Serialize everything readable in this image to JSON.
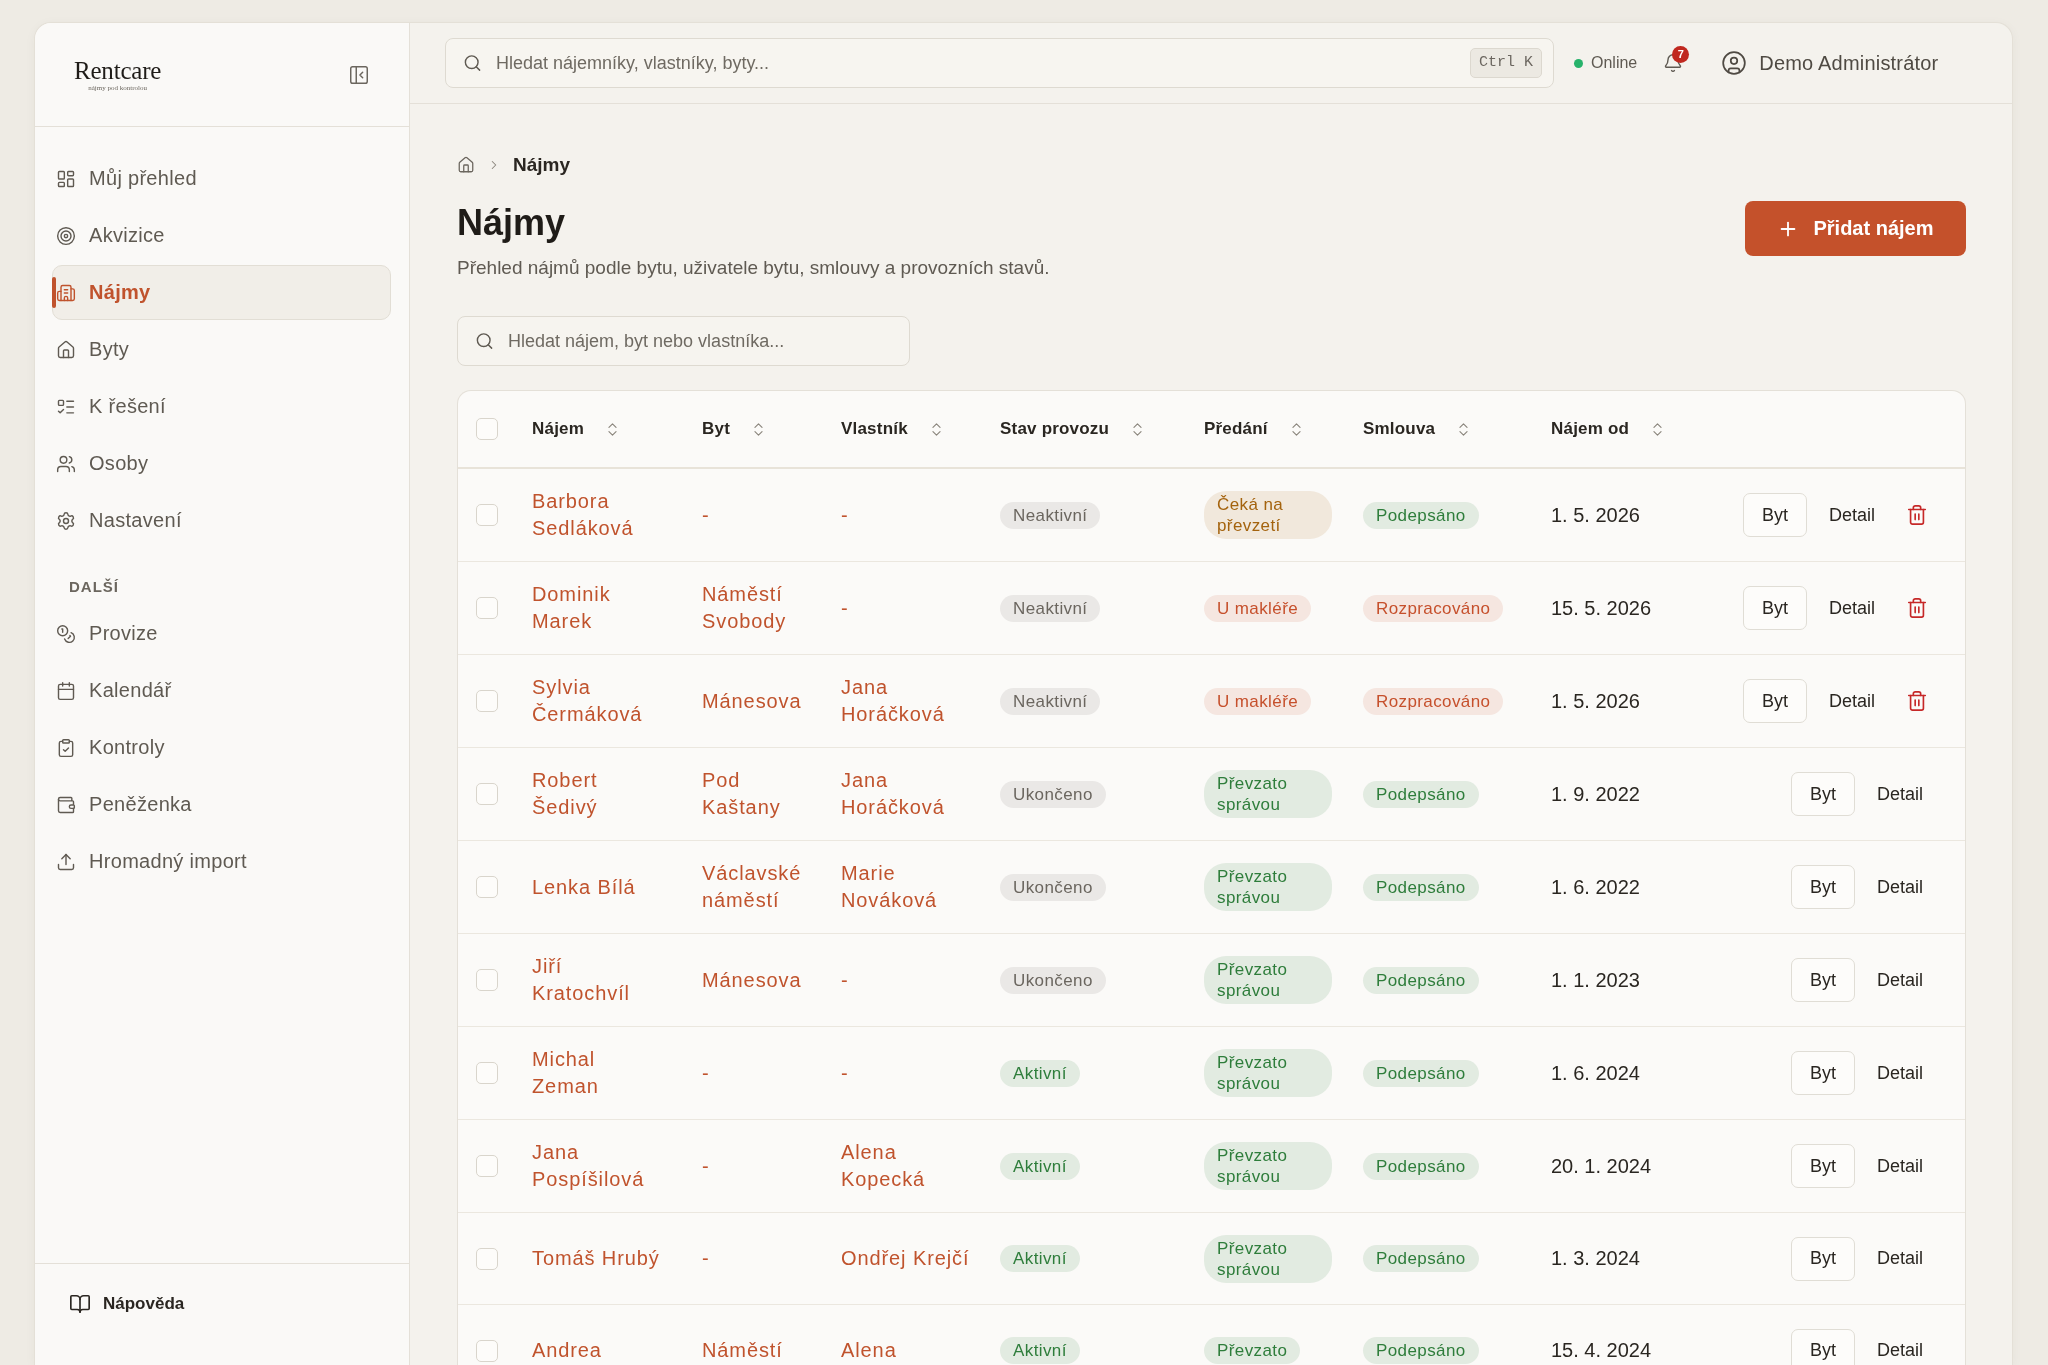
{
  "sidebar": {
    "brand": {
      "name": "Rentcare",
      "tagline": "nájmy pod kontrolou"
    },
    "items": [
      {
        "label": "Můj přehled",
        "selected": false
      },
      {
        "label": "Akvizice",
        "selected": false
      },
      {
        "label": "Nájmy",
        "selected": true
      },
      {
        "label": "Byty",
        "selected": false
      },
      {
        "label": "K řešení",
        "selected": false
      },
      {
        "label": "Osoby",
        "selected": false
      },
      {
        "label": "Nastavení",
        "selected": false
      }
    ],
    "section": {
      "title": "DALŠÍ",
      "items": [
        {
          "label": "Provize",
          "selected": false
        },
        {
          "label": "Kalendář",
          "selected": false
        },
        {
          "label": "Kontroly",
          "selected": false
        },
        {
          "label": "Peněženka",
          "selected": false
        },
        {
          "label": "Hromadný import",
          "selected": false
        }
      ]
    },
    "footer": {
      "label": "Nápověda"
    }
  },
  "topbar": {
    "search": {
      "placeholder": "Hledat nájemníky, vlastníky, byty...",
      "shortcut": "Ctrl K"
    },
    "status": {
      "label": "Online",
      "online": true
    },
    "notifications": {
      "count": "7"
    },
    "user": {
      "name": "Demo Administrátor"
    }
  },
  "breadcrumb": {
    "current": "Nájmy"
  },
  "page": {
    "title": "Nájmy",
    "subtitle": "Přehled nájmů podle bytu, uživatele bytu, smlouvy a provozních stavů.",
    "primary_action": {
      "label": "Přidat nájem"
    }
  },
  "filter": {
    "placeholder": "Hledat nájem, byt nebo vlastníka..."
  },
  "table": {
    "select_all": {
      "checked": false
    },
    "columns": [
      {
        "label": "Nájem",
        "sortable": true
      },
      {
        "label": "Byt",
        "sortable": true
      },
      {
        "label": "Vlastník",
        "sortable": true
      },
      {
        "label": "Stav provozu",
        "sortable": true
      },
      {
        "label": "Předání",
        "sortable": true
      },
      {
        "label": "Smlouva",
        "sortable": true
      },
      {
        "label": "Nájem od",
        "sortable": true
      }
    ],
    "rows": [
      {
        "selected": false,
        "tenant": "Barbora Sedláková",
        "apartment": "-",
        "owner": "-",
        "operation_status": {
          "label": "Neaktivní",
          "color": "#6b665f"
        },
        "handover": {
          "label": "Čeká na převzetí",
          "color": "#a4630e"
        },
        "contract": {
          "label": "Podepsáno",
          "color": "#2e7d3b"
        },
        "start_date": "1. 5. 2026",
        "actions": [
          {
            "label": "Byt",
            "kind": "outline"
          },
          {
            "label": "Detail",
            "kind": "ghost"
          }
        ],
        "deletable": true
      },
      {
        "selected": false,
        "tenant": "Dominik Marek",
        "apartment": "Náměstí Svobody",
        "owner": "-",
        "operation_status": {
          "label": "Neaktivní",
          "color": "#6b665f"
        },
        "handover": {
          "label": "U makléře",
          "color": "#c6502c"
        },
        "contract": {
          "label": "Rozpracováno",
          "color": "#c6502c"
        },
        "start_date": "15. 5. 2026",
        "actions": [
          {
            "label": "Byt",
            "kind": "outline"
          },
          {
            "label": "Detail",
            "kind": "ghost"
          }
        ],
        "deletable": true
      },
      {
        "selected": false,
        "tenant": "Sylvia Čermáková",
        "apartment": "Mánesova",
        "owner": "Jana Horáčková",
        "operation_status": {
          "label": "Neaktivní",
          "color": "#6b665f"
        },
        "handover": {
          "label": "U makléře",
          "color": "#c6502c"
        },
        "contract": {
          "label": "Rozpracováno",
          "color": "#c6502c"
        },
        "start_date": "1. 5. 2026",
        "actions": [
          {
            "label": "Byt",
            "kind": "outline"
          },
          {
            "label": "Detail",
            "kind": "ghost"
          }
        ],
        "deletable": true
      },
      {
        "selected": false,
        "tenant": "Robert Šedivý",
        "apartment": "Pod Kaštany",
        "owner": "Jana Horáčková",
        "operation_status": {
          "label": "Ukončeno",
          "color": "#6b665f"
        },
        "handover": {
          "label": "Převzato správou",
          "color": "#2e7d3b"
        },
        "contract": {
          "label": "Podepsáno",
          "color": "#2e7d3b"
        },
        "start_date": "1. 9. 2022",
        "actions": [
          {
            "label": "Byt",
            "kind": "outline"
          },
          {
            "label": "Detail",
            "kind": "ghost"
          }
        ],
        "deletable": false
      },
      {
        "selected": false,
        "tenant": "Lenka Bílá",
        "apartment": "Václavské náměstí",
        "owner": "Marie Nováková",
        "operation_status": {
          "label": "Ukončeno",
          "color": "#6b665f"
        },
        "handover": {
          "label": "Převzato správou",
          "color": "#2e7d3b"
        },
        "contract": {
          "label": "Podepsáno",
          "color": "#2e7d3b"
        },
        "start_date": "1. 6. 2022",
        "actions": [
          {
            "label": "Byt",
            "kind": "outline"
          },
          {
            "label": "Detail",
            "kind": "ghost"
          }
        ],
        "deletable": false
      },
      {
        "selected": false,
        "tenant": "Jiří Kratochvíl",
        "apartment": "Mánesova",
        "owner": "-",
        "operation_status": {
          "label": "Ukončeno",
          "color": "#6b665f"
        },
        "handover": {
          "label": "Převzato správou",
          "color": "#2e7d3b"
        },
        "contract": {
          "label": "Podepsáno",
          "color": "#2e7d3b"
        },
        "start_date": "1. 1. 2023",
        "actions": [
          {
            "label": "Byt",
            "kind": "outline"
          },
          {
            "label": "Detail",
            "kind": "ghost"
          }
        ],
        "deletable": false
      },
      {
        "selected": false,
        "tenant": "Michal Zeman",
        "apartment": "-",
        "owner": "-",
        "operation_status": {
          "label": "Aktivní",
          "color": "#2e7d3b"
        },
        "handover": {
          "label": "Převzato správou",
          "color": "#2e7d3b"
        },
        "contract": {
          "label": "Podepsáno",
          "color": "#2e7d3b"
        },
        "start_date": "1. 6. 2024",
        "actions": [
          {
            "label": "Byt",
            "kind": "outline"
          },
          {
            "label": "Detail",
            "kind": "ghost"
          }
        ],
        "deletable": false
      },
      {
        "selected": false,
        "tenant": "Jana Pospíšilová",
        "apartment": "-",
        "owner": "Alena Kopecká",
        "operation_status": {
          "label": "Aktivní",
          "color": "#2e7d3b"
        },
        "handover": {
          "label": "Převzato správou",
          "color": "#2e7d3b"
        },
        "contract": {
          "label": "Podepsáno",
          "color": "#2e7d3b"
        },
        "start_date": "20. 1. 2024",
        "actions": [
          {
            "label": "Byt",
            "kind": "outline"
          },
          {
            "label": "Detail",
            "kind": "ghost"
          }
        ],
        "deletable": false
      },
      {
        "selected": false,
        "tenant": "Tomáš Hrubý",
        "apartment": "-",
        "owner": "Ondřej Krejčí",
        "operation_status": {
          "label": "Aktivní",
          "color": "#2e7d3b"
        },
        "handover": {
          "label": "Převzato správou",
          "color": "#2e7d3b"
        },
        "contract": {
          "label": "Podepsáno",
          "color": "#2e7d3b"
        },
        "start_date": "1. 3. 2024",
        "actions": [
          {
            "label": "Byt",
            "kind": "outline"
          },
          {
            "label": "Detail",
            "kind": "ghost"
          }
        ],
        "deletable": false
      },
      {
        "selected": false,
        "tenant": "Andrea",
        "apartment": "Náměstí",
        "owner": "Alena",
        "operation_status": {
          "label": "Aktivní",
          "color": "#2e7d3b"
        },
        "handover": {
          "label": "Převzato",
          "color": "#2e7d3b"
        },
        "contract": {
          "label": "Podepsáno",
          "color": "#2e7d3b"
        },
        "start_date": "15. 4. 2024",
        "actions": [
          {
            "label": "Byt",
            "kind": "outline"
          },
          {
            "label": "Detail",
            "kind": "ghost"
          }
        ],
        "deletable": false
      }
    ]
  }
}
